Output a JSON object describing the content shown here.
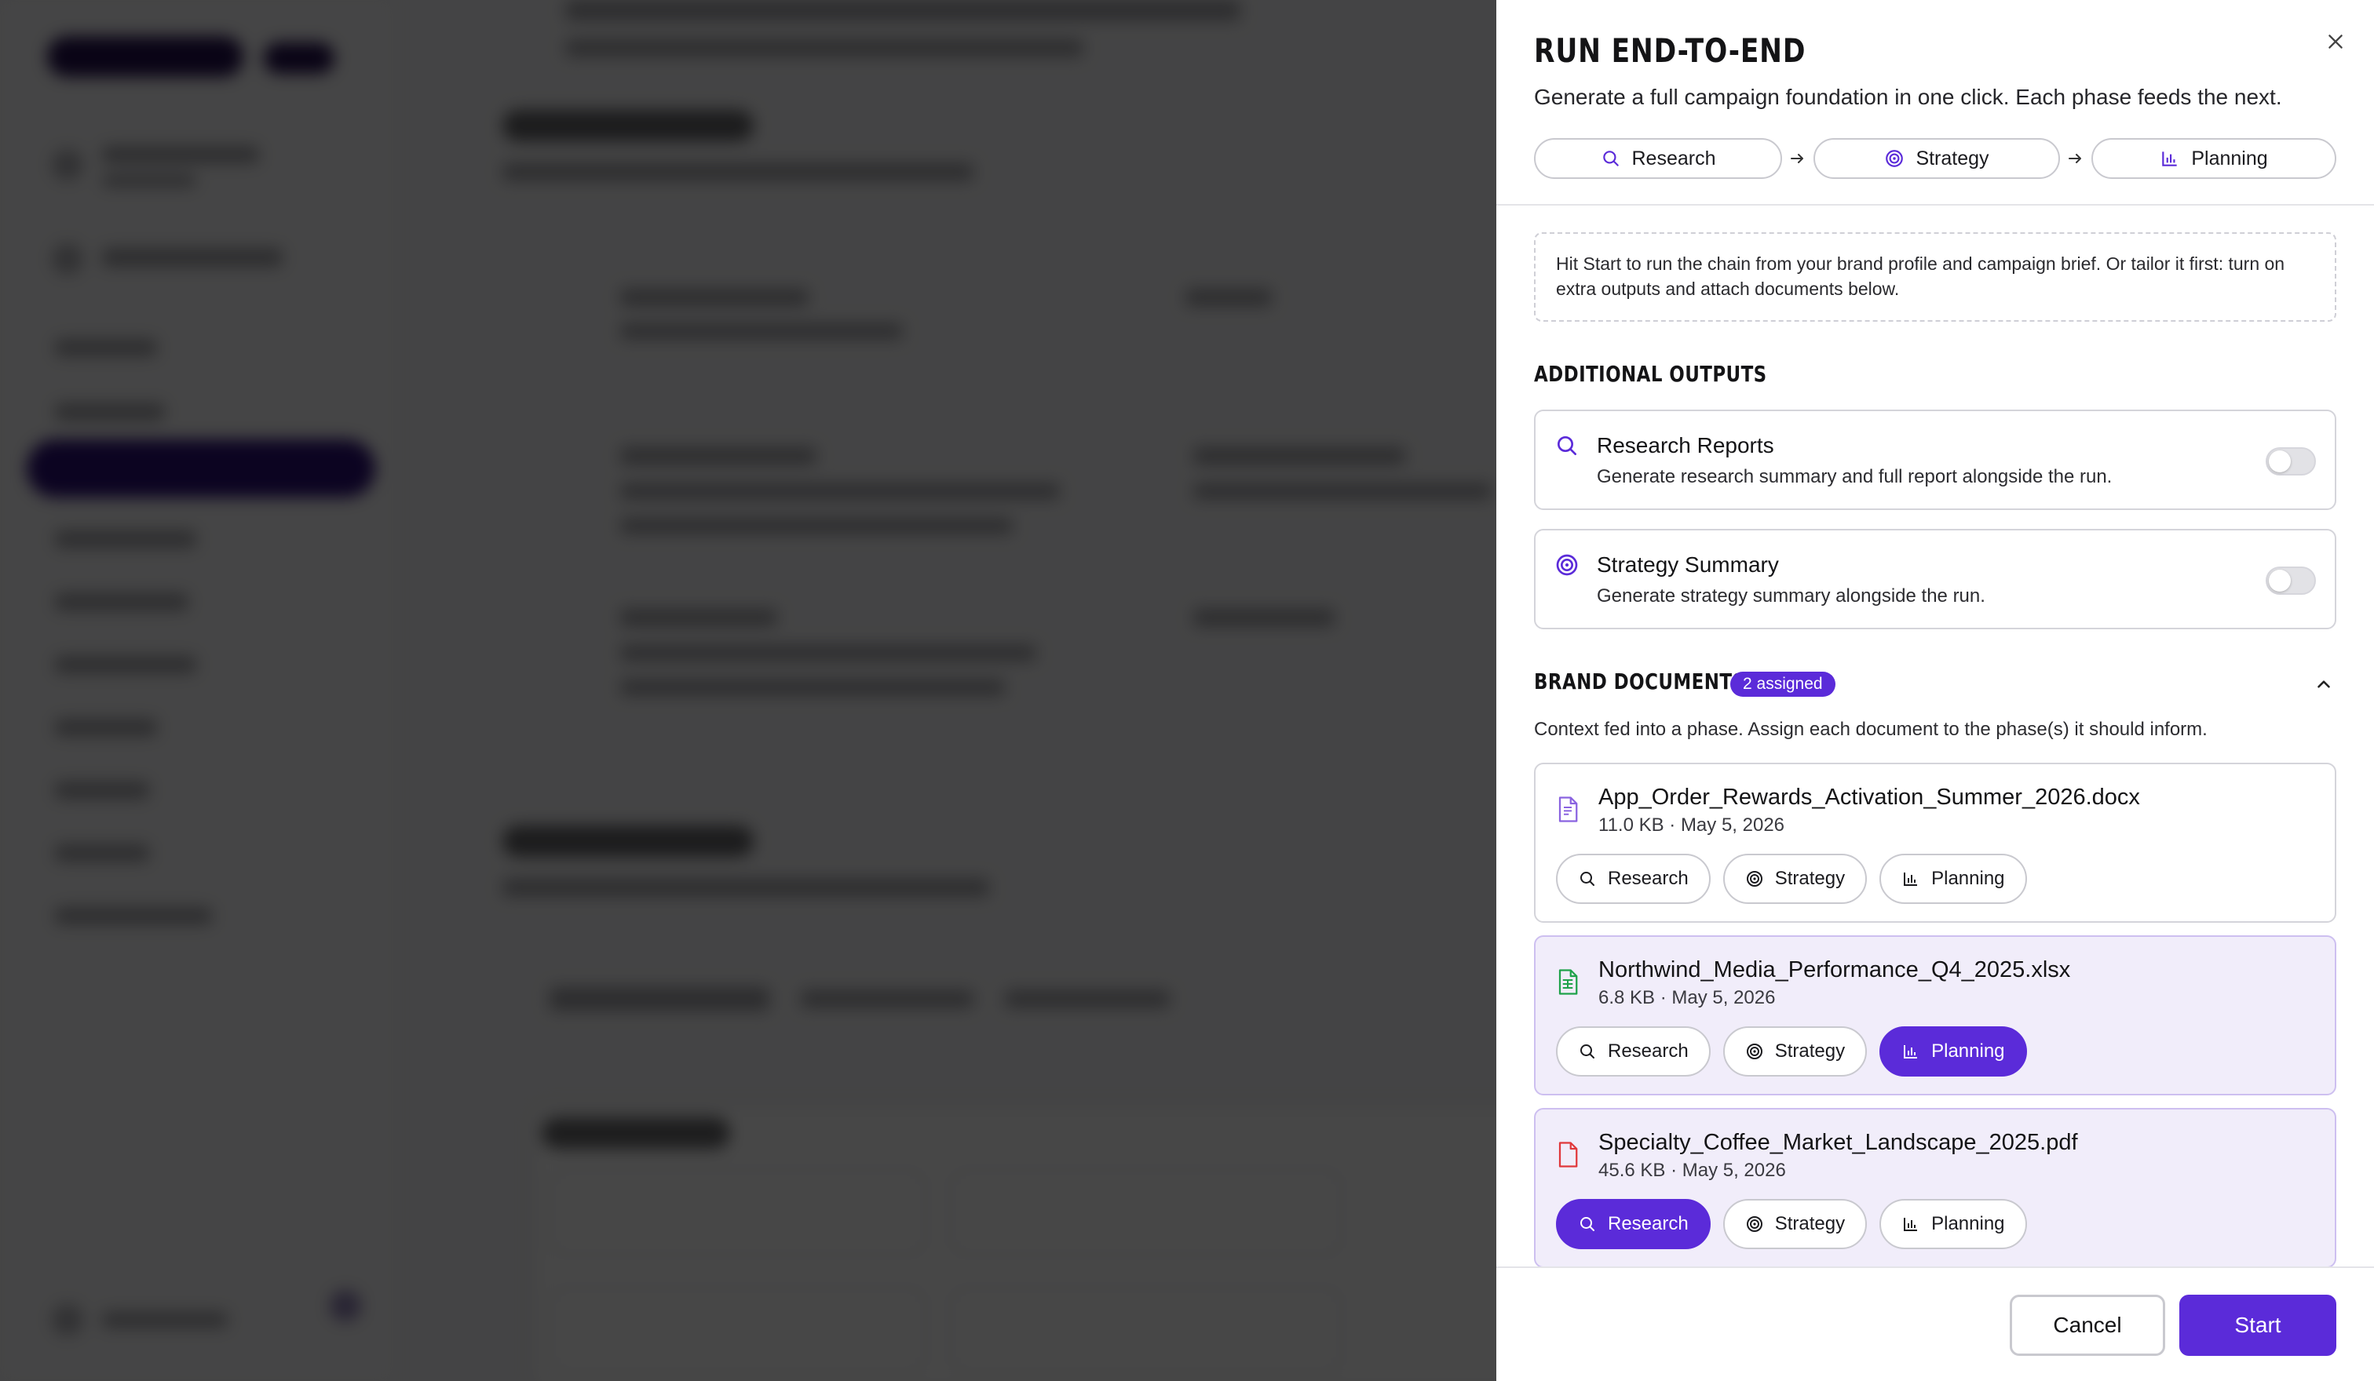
{
  "drawer": {
    "title": "RUN END-TO-END",
    "subtitle": "Generate a full campaign foundation in one click. Each phase feeds the next.",
    "pipeline": [
      "Research",
      "Strategy",
      "Planning"
    ],
    "hint": "Hit Start to run the chain from your brand profile and campaign brief. Or tailor it first: turn on extra outputs and attach documents below."
  },
  "outputs": {
    "heading": "ADDITIONAL OUTPUTS",
    "items": [
      {
        "title": "Research Reports",
        "desc": "Generate research summary and full report alongside the run.",
        "enabled": false
      },
      {
        "title": "Strategy Summary",
        "desc": "Generate strategy summary alongside the run.",
        "enabled": false
      }
    ]
  },
  "brand_docs": {
    "heading": "BRAND DOCUMENTS",
    "badge": "2 assigned",
    "desc": "Context fed into a phase. Assign each document to the phase(s) it should inform.",
    "chip_labels": [
      "Research",
      "Strategy",
      "Planning"
    ],
    "items": [
      {
        "name": "App_Order_Rewards_Activation_Summer_2026.docx",
        "meta": "11.0 KB · May 5, 2026",
        "icon": "doc-icon",
        "icon_color": "#8a63e0",
        "active": []
      },
      {
        "name": "Northwind_Media_Performance_Q4_2025.xlsx",
        "meta": "6.8 KB · May 5, 2026",
        "icon": "spreadsheet-icon",
        "icon_color": "#1fa24a",
        "active": [
          "Planning"
        ]
      },
      {
        "name": "Specialty_Coffee_Market_Landscape_2025.pdf",
        "meta": "45.6 KB · May 5, 2026",
        "icon": "pdf-icon",
        "icon_color": "#e0383b",
        "active": [
          "Research"
        ]
      }
    ]
  },
  "footer": {
    "cancel": "Cancel",
    "start": "Start"
  },
  "colors": {
    "accent": "#5b2bd9",
    "accent_tint": "#f1edfa"
  }
}
